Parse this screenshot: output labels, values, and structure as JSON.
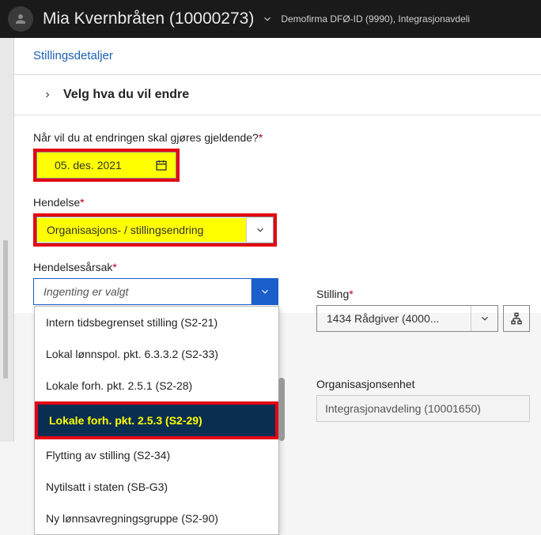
{
  "header": {
    "person_name": "Mia Kvernbråten (10000273)",
    "org_info": "Demofirma DFØ-ID (9990), Integrasjonavdeli"
  },
  "breadcrumb": "Stillingsdetaljer",
  "section_title": "Velg hva du vil endre",
  "form": {
    "date_label": "Når vil du at endringen skal gjøres gjeldende?",
    "date_value": "05. des. 2021",
    "event_label": "Hendelse",
    "event_value": "Organisasjons- / stillingsendring",
    "reason_label": "Hendelsesårsak",
    "reason_placeholder": "Ingenting er valgt",
    "reason_options": [
      "Intern tidsbegrenset stilling (S2-21)",
      "Lokal lønnspol. pkt. 6.3.3.2 (S2-33)",
      "Lokale forh. pkt. 2.5.1 (S2-28)",
      "Lokale forh. pkt. 2.5.3 (S2-29)",
      "Flytting av stilling (S2-34)",
      "Nytilsatt i staten (SB-G3)",
      "Ny lønnsavregningsgruppe (S2-90)"
    ],
    "position_label": "Stilling",
    "position_value": "1434 Rådgiver (4000...",
    "orgunit_label": "Organisasjonsenhet",
    "orgunit_value": "Integrasjonavdeling (10001650)"
  }
}
